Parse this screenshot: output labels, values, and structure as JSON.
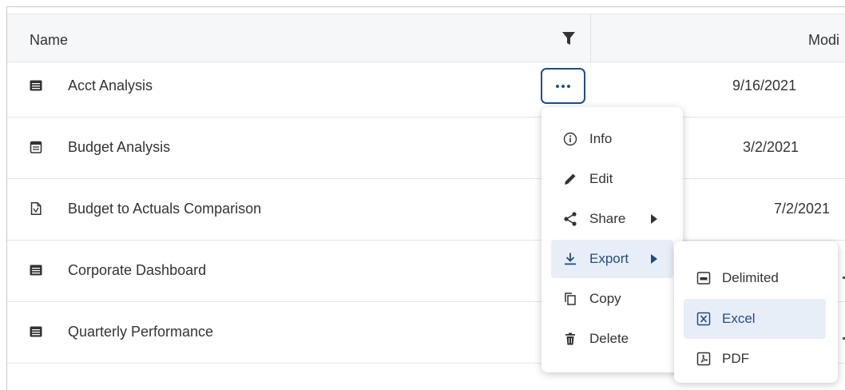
{
  "table": {
    "columns": {
      "name": "Name",
      "modified": "Modi"
    },
    "rows": [
      {
        "name": "Acct Analysis",
        "modified": "9/16/2021 ",
        "icon": "table-report-icon"
      },
      {
        "name": "Budget Analysis",
        "modified": "3/2/2021 ",
        "icon": "calendar-report-icon"
      },
      {
        "name": "Budget to Actuals Comparison",
        "modified": "7/2/2021",
        "icon": "document-chart-icon"
      },
      {
        "name": "Corporate Dashboard",
        "modified": "",
        "icon": "table-report-icon"
      },
      {
        "name": "Quarterly Performance",
        "modified": "",
        "icon": "table-report-icon"
      }
    ]
  },
  "context_menu": {
    "items": [
      {
        "label": "Info",
        "icon": "info-icon"
      },
      {
        "label": "Edit",
        "icon": "pencil-icon"
      },
      {
        "label": "Share",
        "icon": "share-icon",
        "has_submenu": true
      },
      {
        "label": "Export",
        "icon": "download-icon",
        "has_submenu": true,
        "active": true
      },
      {
        "label": "Copy",
        "icon": "copy-icon"
      },
      {
        "label": "Delete",
        "icon": "trash-icon"
      }
    ]
  },
  "export_submenu": {
    "items": [
      {
        "label": "Delimited",
        "icon": "csv-file-icon"
      },
      {
        "label": "Excel",
        "icon": "excel-file-icon",
        "active": true
      },
      {
        "label": "PDF",
        "icon": "pdf-file-icon"
      }
    ]
  },
  "colors": {
    "accent": "#1f4e86",
    "highlight": "#e8eef8",
    "header_bg": "#f6f7f9",
    "text": "#333333"
  }
}
